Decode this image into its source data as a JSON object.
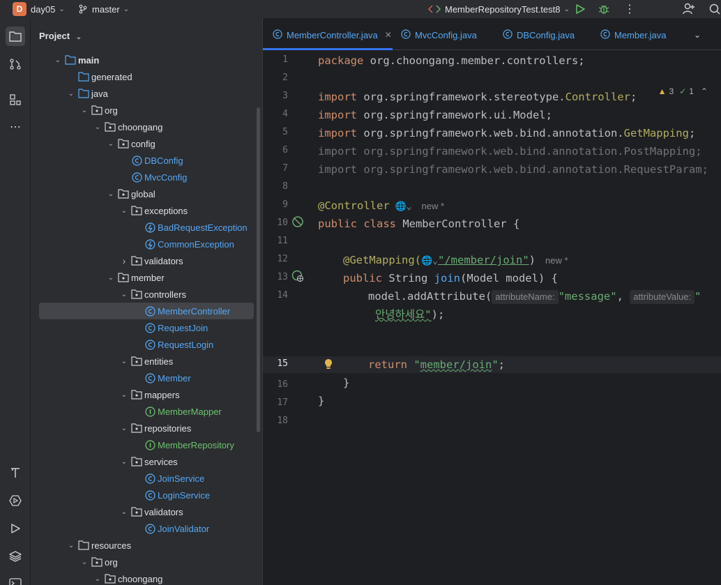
{
  "titlebar": {
    "project_badge": "D",
    "project_name": "day05",
    "branch": "master",
    "run_config": "MemberRepositoryTest.test8"
  },
  "toolstrip": {
    "top": [
      "folder-icon",
      "commit-icon",
      "structure-icon",
      "more-icon"
    ],
    "bottom": [
      "build-icon",
      "services-icon",
      "run-icon",
      "layers-icon",
      "terminal-icon"
    ]
  },
  "project_panel": {
    "title": "Project",
    "tree": [
      {
        "label": "main",
        "depth": 0,
        "arrow": "down",
        "icon": "folder-source"
      },
      {
        "label": "generated",
        "depth": 1,
        "arrow": "",
        "icon": "folder-generated"
      },
      {
        "label": "java",
        "depth": 1,
        "arrow": "down",
        "icon": "folder-blue"
      },
      {
        "label": "org",
        "depth": 2,
        "arrow": "down",
        "icon": "package"
      },
      {
        "label": "choongang",
        "depth": 3,
        "arrow": "down",
        "icon": "package"
      },
      {
        "label": "config",
        "depth": 4,
        "arrow": "down",
        "icon": "package"
      },
      {
        "label": "DBConfig",
        "depth": 5,
        "arrow": "",
        "icon": "class"
      },
      {
        "label": "MvcConfig",
        "depth": 5,
        "arrow": "",
        "icon": "class"
      },
      {
        "label": "global",
        "depth": 4,
        "arrow": "down",
        "icon": "package"
      },
      {
        "label": "exceptions",
        "depth": 5,
        "arrow": "down",
        "icon": "package"
      },
      {
        "label": "BadRequestException",
        "depth": 6,
        "arrow": "",
        "icon": "exception"
      },
      {
        "label": "CommonException",
        "depth": 6,
        "arrow": "",
        "icon": "exception"
      },
      {
        "label": "validators",
        "depth": 5,
        "arrow": "right",
        "icon": "package"
      },
      {
        "label": "member",
        "depth": 4,
        "arrow": "down",
        "icon": "package"
      },
      {
        "label": "controllers",
        "depth": 5,
        "arrow": "down",
        "icon": "package"
      },
      {
        "label": "MemberController",
        "depth": 6,
        "arrow": "",
        "icon": "class",
        "selected": true
      },
      {
        "label": "RequestJoin",
        "depth": 6,
        "arrow": "",
        "icon": "class"
      },
      {
        "label": "RequestLogin",
        "depth": 6,
        "arrow": "",
        "icon": "class"
      },
      {
        "label": "entities",
        "depth": 5,
        "arrow": "down",
        "icon": "package"
      },
      {
        "label": "Member",
        "depth": 6,
        "arrow": "",
        "icon": "class"
      },
      {
        "label": "mappers",
        "depth": 5,
        "arrow": "down",
        "icon": "package"
      },
      {
        "label": "MemberMapper",
        "depth": 6,
        "arrow": "",
        "icon": "interface"
      },
      {
        "label": "repositories",
        "depth": 5,
        "arrow": "down",
        "icon": "package"
      },
      {
        "label": "MemberRepository",
        "depth": 6,
        "arrow": "",
        "icon": "interface"
      },
      {
        "label": "services",
        "depth": 5,
        "arrow": "down",
        "icon": "package"
      },
      {
        "label": "JoinService",
        "depth": 6,
        "arrow": "",
        "icon": "class"
      },
      {
        "label": "LoginService",
        "depth": 6,
        "arrow": "",
        "icon": "class"
      },
      {
        "label": "validators",
        "depth": 5,
        "arrow": "down",
        "icon": "package"
      },
      {
        "label": "JoinValidator",
        "depth": 6,
        "arrow": "",
        "icon": "class"
      },
      {
        "label": "resources",
        "depth": 1,
        "arrow": "down",
        "icon": "folder-resources"
      },
      {
        "label": "org",
        "depth": 2,
        "arrow": "down",
        "icon": "package"
      },
      {
        "label": "choongang",
        "depth": 3,
        "arrow": "down",
        "icon": "package"
      }
    ]
  },
  "editor": {
    "tabs": [
      {
        "label": "MemberController.java",
        "active": true
      },
      {
        "label": "MvcConfig.java",
        "active": false
      },
      {
        "label": "DBConfig.java",
        "active": false
      },
      {
        "label": "Member.java",
        "active": false
      }
    ],
    "inspections": {
      "warnings": "3",
      "ok": "1"
    },
    "line_numbers": [
      "1",
      "2",
      "3",
      "4",
      "5",
      "6",
      "7",
      "8",
      "9",
      "10",
      "11",
      "12",
      "13",
      "14",
      "",
      "15",
      "16",
      "17",
      "18"
    ],
    "current_line": "15",
    "code": {
      "l1_kw": "package",
      "l1_rest": " org.choongang.member.controllers;",
      "l3_kw": "import",
      "l3_a": " org.springframework.stereotype.",
      "l3_b": "Controller",
      "l3_c": ";",
      "l4_kw": "import",
      "l4_rest": " org.springframework.ui.Model;",
      "l5_kw": "import",
      "l5_a": " org.springframework.web.bind.annotation.",
      "l5_b": "GetMapping",
      "l5_c": ";",
      "l6": "import org.springframework.web.bind.annotation.PostMapping;",
      "l7": "import org.springframework.web.bind.annotation.RequestParam;",
      "l9_ann": "@Controller",
      "l9_hint": "new *",
      "l10_kw": "public class",
      "l10_rest": " MemberController {",
      "l12_ann": "@GetMapping(",
      "l12_url": "\"/member/join\"",
      "l12_close": ")",
      "l12_hint": "new *",
      "l13_kw": "public",
      "l13_a": " String ",
      "l13_fn": "join",
      "l13_b": "(Model model) {",
      "l14_a": "model.addAttribute(",
      "l14_inlay1": "attributeName:",
      "l14_str1": "\"message\"",
      "l14_b": ", ",
      "l14_inlay2": "attributeValue:",
      "l14_q": "\"",
      "l14w_str": "안녕하세요\"",
      "l14w_rest": ");",
      "l15_kw": "return",
      "l15_str_a": " \"",
      "l15_str_b": "member/join",
      "l15_str_c": "\"",
      "l15_rest": ";",
      "l16": "}",
      "l17": "}"
    }
  }
}
